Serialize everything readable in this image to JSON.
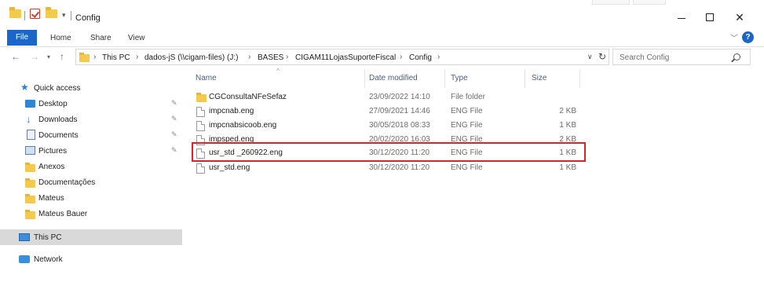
{
  "window": {
    "title": "Config",
    "controls": {
      "minimize": "—",
      "maximize": "□",
      "close": "✕"
    }
  },
  "ribbon": {
    "tabs": [
      "File",
      "Home",
      "Share",
      "View"
    ],
    "expand_icon": "chevron-down-icon",
    "help_label": "?"
  },
  "address": {
    "breadcrumbs": [
      "This PC",
      "dados-jS (\\\\cigam-files) (J:)",
      "BASES",
      "CIGAM11LojasSuporteFiscal",
      "Config"
    ],
    "search_placeholder": "Search Config"
  },
  "nav": {
    "quick_access": "Quick access",
    "items": [
      {
        "label": "Desktop",
        "icon": "desktop-icon",
        "pinned": true
      },
      {
        "label": "Downloads",
        "icon": "download-icon",
        "pinned": true
      },
      {
        "label": "Documents",
        "icon": "documents-icon",
        "pinned": true
      },
      {
        "label": "Pictures",
        "icon": "pictures-icon",
        "pinned": true
      },
      {
        "label": "Anexos",
        "icon": "folder-icon",
        "pinned": false
      },
      {
        "label": "Documentações",
        "icon": "folder-icon",
        "pinned": false
      },
      {
        "label": "Mateus",
        "icon": "folder-icon",
        "pinned": false
      },
      {
        "label": "Mateus Bauer",
        "icon": "folder-icon",
        "pinned": false
      }
    ],
    "this_pc": "This PC",
    "network": "Network"
  },
  "columns": {
    "name": "Name",
    "date": "Date modified",
    "type": "Type",
    "size": "Size"
  },
  "files": [
    {
      "name": "CGConsultaNFeSefaz",
      "date": "23/09/2022 14:10",
      "type": "File folder",
      "size": "",
      "icon": "folder-icon"
    },
    {
      "name": "impcnab.eng",
      "date": "27/09/2021 14:46",
      "type": "ENG File",
      "size": "2 KB",
      "icon": "file-icon"
    },
    {
      "name": "impcnabsicoob.eng",
      "date": "30/05/2018 08:33",
      "type": "ENG File",
      "size": "1 KB",
      "icon": "file-icon"
    },
    {
      "name": "impsped.eng",
      "date": "20/02/2020 16:03",
      "type": "ENG File",
      "size": "2 KB",
      "icon": "file-icon"
    },
    {
      "name": "usr_std _260922.eng",
      "date": "30/12/2020 11:20",
      "type": "ENG File",
      "size": "1 KB",
      "icon": "file-icon",
      "highlighted": true
    },
    {
      "name": "usr_std.eng",
      "date": "30/12/2020 11:20",
      "type": "ENG File",
      "size": "1 KB",
      "icon": "file-icon"
    }
  ],
  "colors": {
    "accent": "#1a67c9",
    "highlight_border": "#d9242c",
    "selected_bg": "#d9d9d9"
  }
}
